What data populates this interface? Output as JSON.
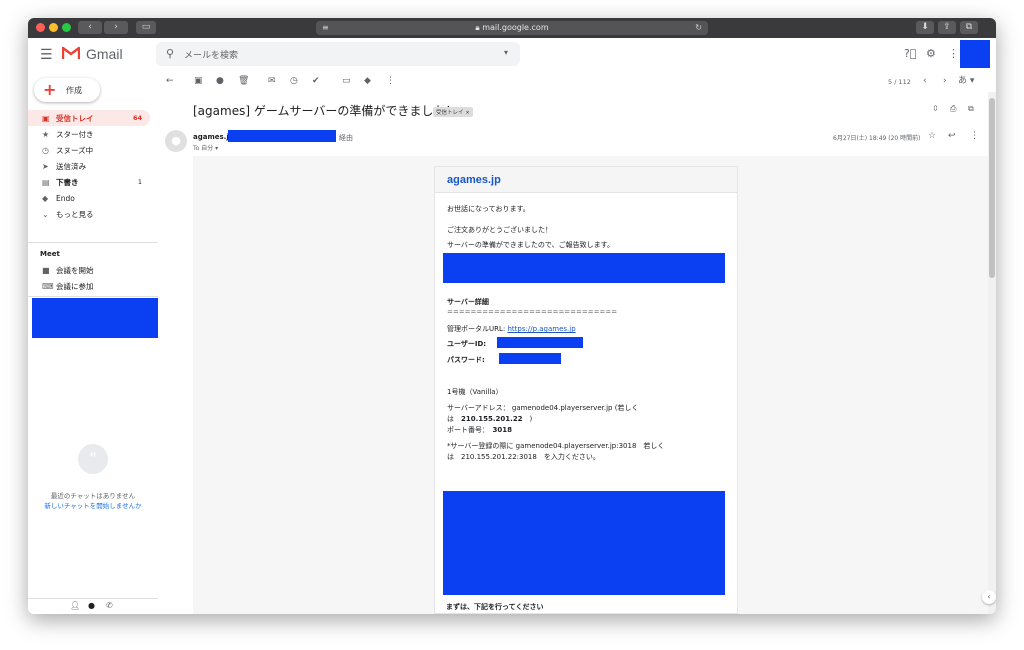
{
  "browser": {
    "url": "mail.google.com",
    "back": "‹",
    "forward": "›"
  },
  "header": {
    "logo_text": "Gmail",
    "search_placeholder": "メールを検索"
  },
  "sidebar": {
    "compose_label": "作成",
    "items": [
      {
        "label": "受信トレイ",
        "count": "64",
        "icon": "inbox-icon"
      },
      {
        "label": "スター付き",
        "count": "",
        "icon": "star-icon"
      },
      {
        "label": "スヌーズ中",
        "count": "",
        "icon": "clock-icon"
      },
      {
        "label": "送信済み",
        "count": "",
        "icon": "send-icon"
      },
      {
        "label": "下書き",
        "count": "1",
        "icon": "draft-icon"
      },
      {
        "label": "Endo",
        "count": "",
        "icon": "label-icon"
      },
      {
        "label": "もっと見る",
        "count": "",
        "icon": "chevron-down-icon"
      }
    ],
    "meet_title": "Meet",
    "meet_items": [
      {
        "label": "会議を開始",
        "icon": "video-icon"
      },
      {
        "label": "会議に参加",
        "icon": "keyboard-icon"
      }
    ],
    "no_chat": "最近のチャットはありません",
    "start_chat": "新しいチャットを開始しませんか"
  },
  "toolbar": {
    "pager": "5 / 112",
    "input_tool": "あ"
  },
  "message": {
    "subject": "[agames] ゲームサーバーの準備ができました！",
    "inbox_chip": "受信トレイ ×",
    "sender": "agames.jp",
    "via": "経由",
    "to": "To 自分 ▾",
    "date": "6月27日(土) 18:49 (20 時間前)"
  },
  "email": {
    "brand": "agames.jp",
    "greeting": "お世話になっております。",
    "thanks": "ご注文ありがとうございました！",
    "ready": "サーバーの準備ができましたので、ご報告致します。",
    "details_title": "サーバー詳細",
    "divider": "=============================",
    "portal_label": "管理ポータルURL:",
    "portal_url": "https://p.agames.jp",
    "user_id_label": "ユーザーID:",
    "password_label": "パスワード:",
    "server_name": "1号機（Vanilla）",
    "address_line1": "サーバーアドレス： gamenode04.playerserver.jp (若しく",
    "address_line2_prefix": "は　",
    "address_ip": "210.155.201.22",
    "address_line2_suffix": "　)",
    "port_label": "ポート番号：　",
    "port": "3018",
    "register_line1": "*サーバー登録の際に gamenode04.playerserver.jp:3018　若しく",
    "register_line2": "は　210.155.201.22:3018　を入力ください。",
    "next_steps": "まずは、下記を行ってください"
  }
}
